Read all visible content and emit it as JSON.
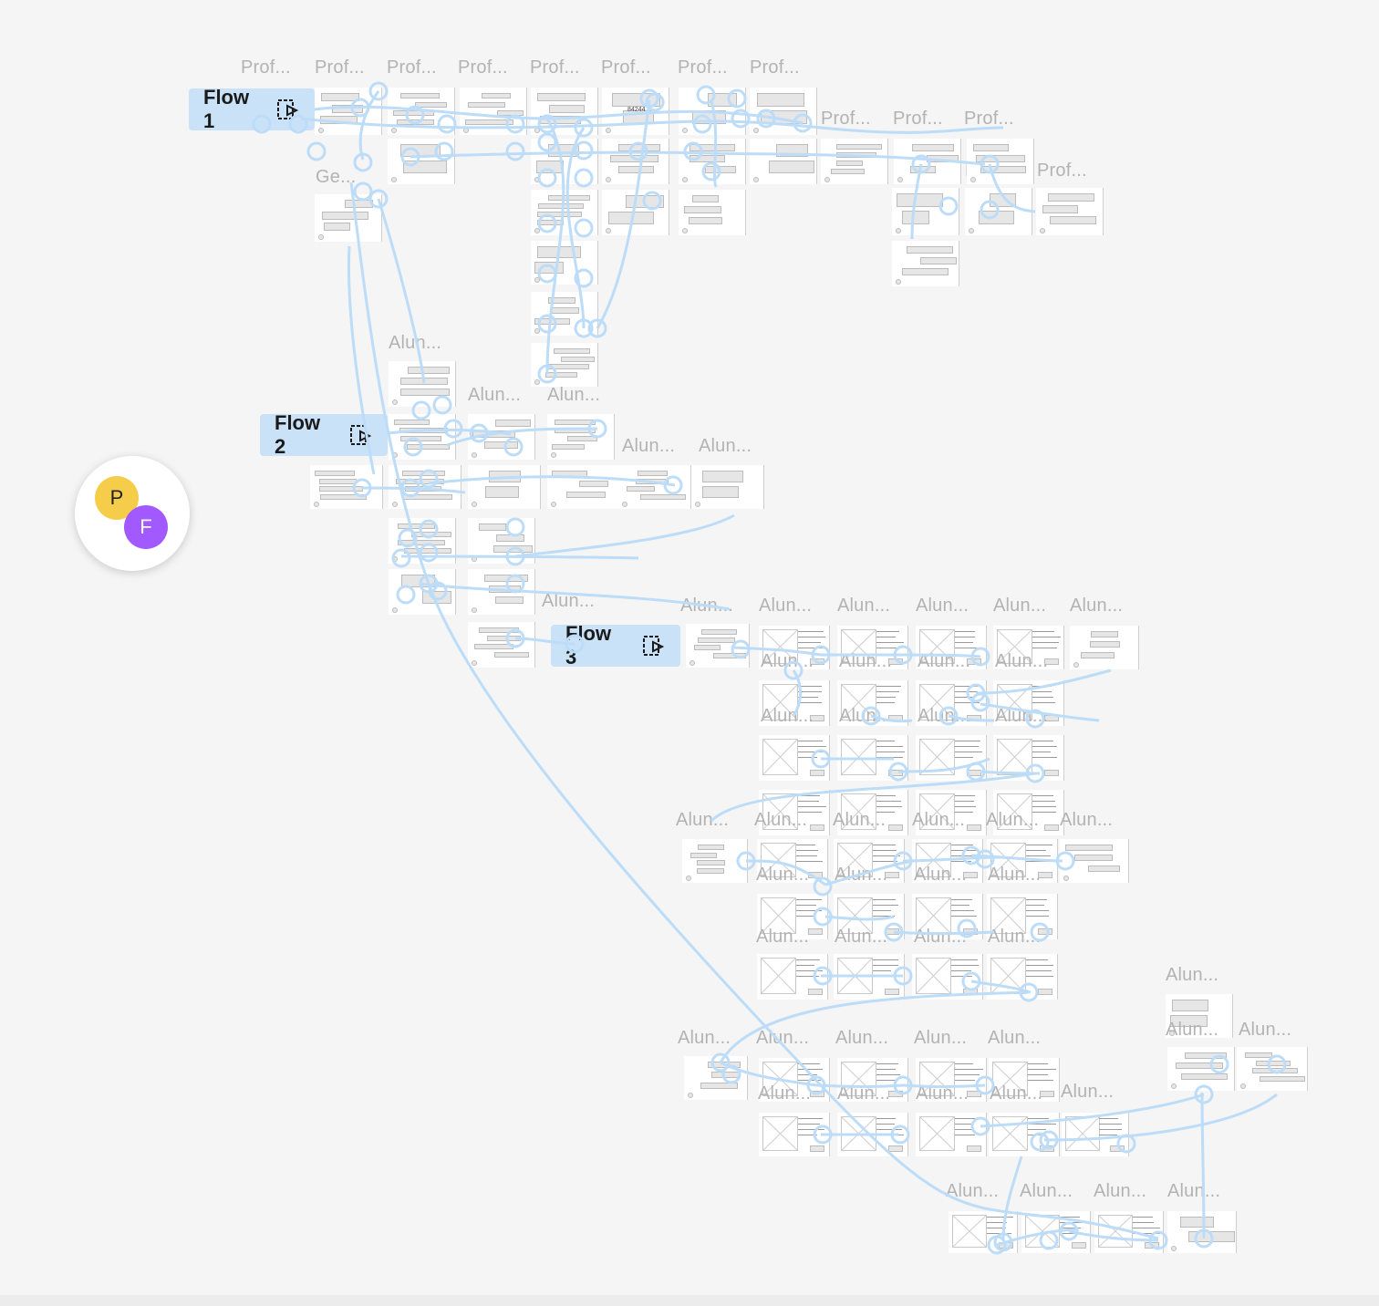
{
  "flows": [
    {
      "label": "Flow 1"
    },
    {
      "label": "Flow 2"
    },
    {
      "label": "Flow 3"
    }
  ],
  "labels": {
    "prof": "Prof...",
    "ge": "Ge...",
    "alun": "Alun...",
    "q": "???..."
  },
  "frame_text": {
    "code_value": "84244"
  },
  "avatars": [
    {
      "initial": "P",
      "color": "#f5cd4a"
    },
    {
      "initial": "F",
      "color": "#a259ff"
    }
  ],
  "colors": {
    "canvas": "#f5f5f5",
    "connector": "#bcdcf8",
    "flow_pill": "#c9e2f7"
  }
}
